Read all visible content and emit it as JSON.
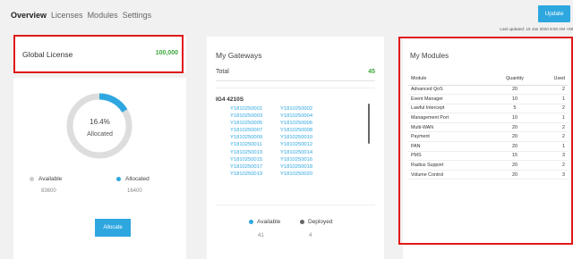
{
  "nav": {
    "tabs": [
      {
        "label": "Overview",
        "active": true
      },
      {
        "label": "Licenses",
        "active": false
      },
      {
        "label": "Modules",
        "active": false
      },
      {
        "label": "Settings",
        "active": false
      }
    ]
  },
  "header": {
    "update_label": "Update",
    "last_updated": "Last updated: 15 Jan 2020 8:00 AM +08"
  },
  "global_license": {
    "title": "Global License",
    "total": "100,000",
    "allocated_fraction": 0.164,
    "percent_text": "16.4%",
    "center_label": "Allocated",
    "available_label": "Available",
    "available_value": "83600",
    "allocated_label": "Allocated",
    "allocated_value": "16400",
    "allocate_button": "Allocate"
  },
  "gateways": {
    "title": "My Gateways",
    "total_label": "Total",
    "total_value": "45",
    "group_name": "IG4 4210S",
    "serials": [
      "Y1810250001",
      "Y1810250002",
      "Y1810250003",
      "Y1810250004",
      "Y1810250005",
      "Y1810250006",
      "Y1810250007",
      "Y1810250008",
      "Y1810250009",
      "Y1810250010",
      "Y1810250011",
      "Y1810250012",
      "Y1810250013",
      "Y1810250014",
      "Y1810250015",
      "Y1810250016",
      "Y1810250017",
      "Y1810250018",
      "Y1810250019",
      "Y1810250020"
    ],
    "available_label": "Available",
    "available_value": "41",
    "deployed_label": "Deployed",
    "deployed_value": "4"
  },
  "modules": {
    "title": "My Modules",
    "columns": [
      "Module",
      "Quantity",
      "Used"
    ],
    "rows": [
      {
        "module": "Advanced QoS",
        "quantity": "20",
        "used": "2"
      },
      {
        "module": "Event Manager",
        "quantity": "10",
        "used": "1"
      },
      {
        "module": "Lawful Intercept",
        "quantity": "5",
        "used": "2"
      },
      {
        "module": "Management Port",
        "quantity": "10",
        "used": "1"
      },
      {
        "module": "Multi-WAN",
        "quantity": "20",
        "used": "2"
      },
      {
        "module": "Payment",
        "quantity": "20",
        "used": "2"
      },
      {
        "module": "PAN",
        "quantity": "20",
        "used": "1"
      },
      {
        "module": "PMS",
        "quantity": "15",
        "used": "3"
      },
      {
        "module": "Radius Support",
        "quantity": "20",
        "used": "2"
      },
      {
        "module": "Volume Control",
        "quantity": "20",
        "used": "3"
      }
    ]
  },
  "colors": {
    "accent": "#2ea7e0",
    "total_green": "#3ca63c",
    "donut_track": "#dddddd",
    "highlight_red": "#e01818",
    "deployed_dot": "#666666",
    "available_dot_gl": "#cccccc"
  }
}
